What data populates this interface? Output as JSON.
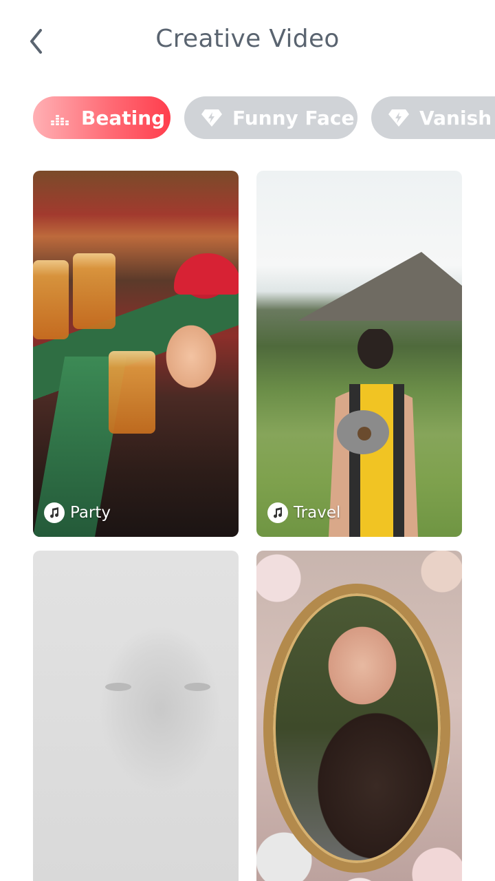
{
  "header": {
    "title": "Creative Video",
    "back_icon": "chevron-left-icon"
  },
  "tabs": [
    {
      "label": "Beating",
      "icon": "equalizer-icon",
      "active": true
    },
    {
      "label": "Funny Face",
      "icon": "diamond-bolt-icon",
      "active": false
    },
    {
      "label": "Vanish m",
      "icon": "diamond-bolt-icon",
      "active": false
    }
  ],
  "cards": [
    {
      "label": "Party",
      "icon": "music-note-icon"
    },
    {
      "label": "Travel",
      "icon": "music-note-icon"
    },
    {
      "label": "",
      "icon": ""
    },
    {
      "label": "",
      "icon": ""
    }
  ],
  "colors": {
    "title": "#5a6470",
    "tab_active_start": "#ffb0b4",
    "tab_active_end": "#ff3e4d",
    "tab_inactive": "#d0d3d7"
  }
}
